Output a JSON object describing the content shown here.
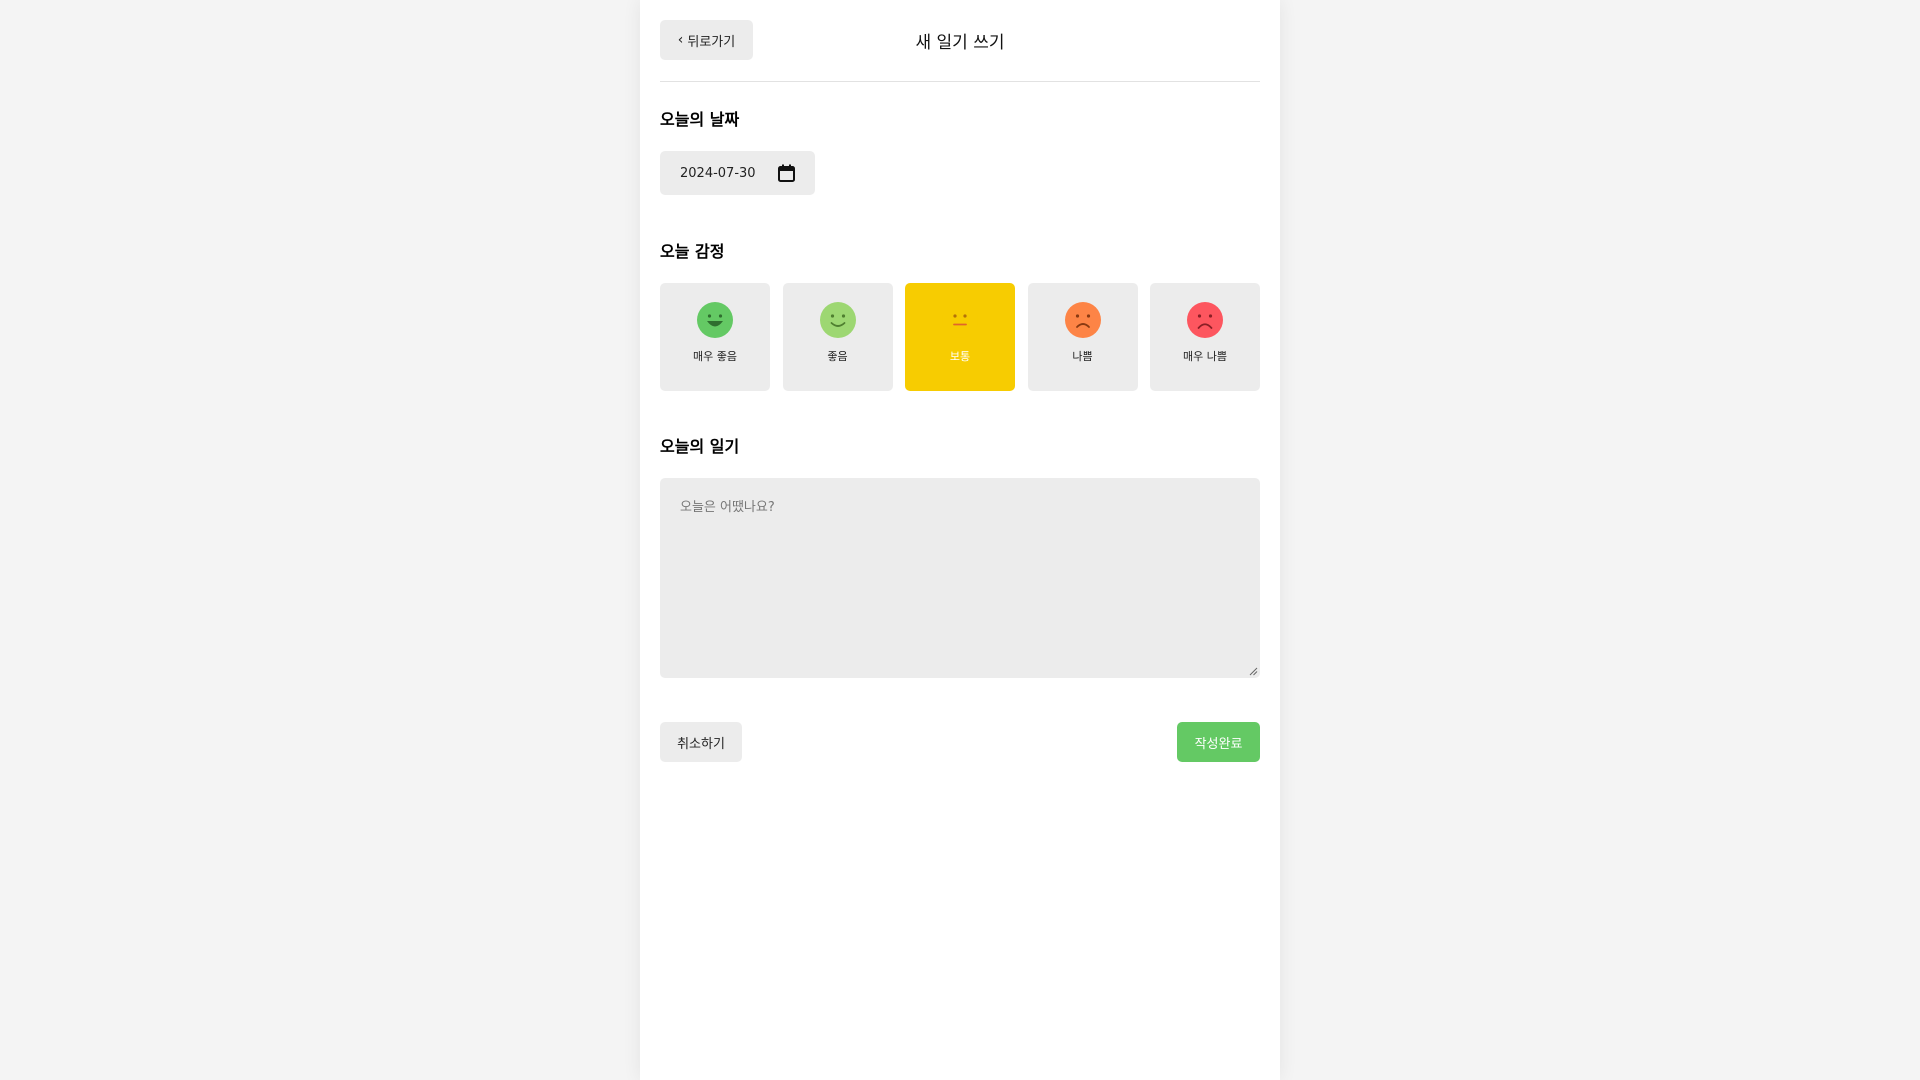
{
  "header": {
    "back_label": "뒤로가기",
    "title": "새 일기 쓰기"
  },
  "date_section": {
    "title": "오늘의 날짜",
    "value": "2024-07-30"
  },
  "emotion_section": {
    "title": "오늘 감정",
    "items": [
      {
        "label": "매우 좋음",
        "color": "#64c964",
        "selected": false,
        "icon": "very-happy-face-icon"
      },
      {
        "label": "좋음",
        "color": "#9dd772",
        "selected": false,
        "icon": "happy-face-icon"
      },
      {
        "label": "보통",
        "color": "#f7cc01",
        "selected": true,
        "icon": "neutral-face-icon"
      },
      {
        "label": "나쁨",
        "color": "#fd8446",
        "selected": false,
        "icon": "sad-face-icon"
      },
      {
        "label": "매우 나쁨",
        "color": "#fd565f",
        "selected": false,
        "icon": "very-sad-face-icon"
      }
    ]
  },
  "diary_section": {
    "title": "오늘의 일기",
    "placeholder": "오늘은 어땠나요?",
    "value": ""
  },
  "footer": {
    "cancel_label": "취소하기",
    "submit_label": "작성완료"
  },
  "colors": {
    "accent_green": "#64c964",
    "selected_yellow": "#f7cc01",
    "neutral_bg": "#ececec"
  }
}
